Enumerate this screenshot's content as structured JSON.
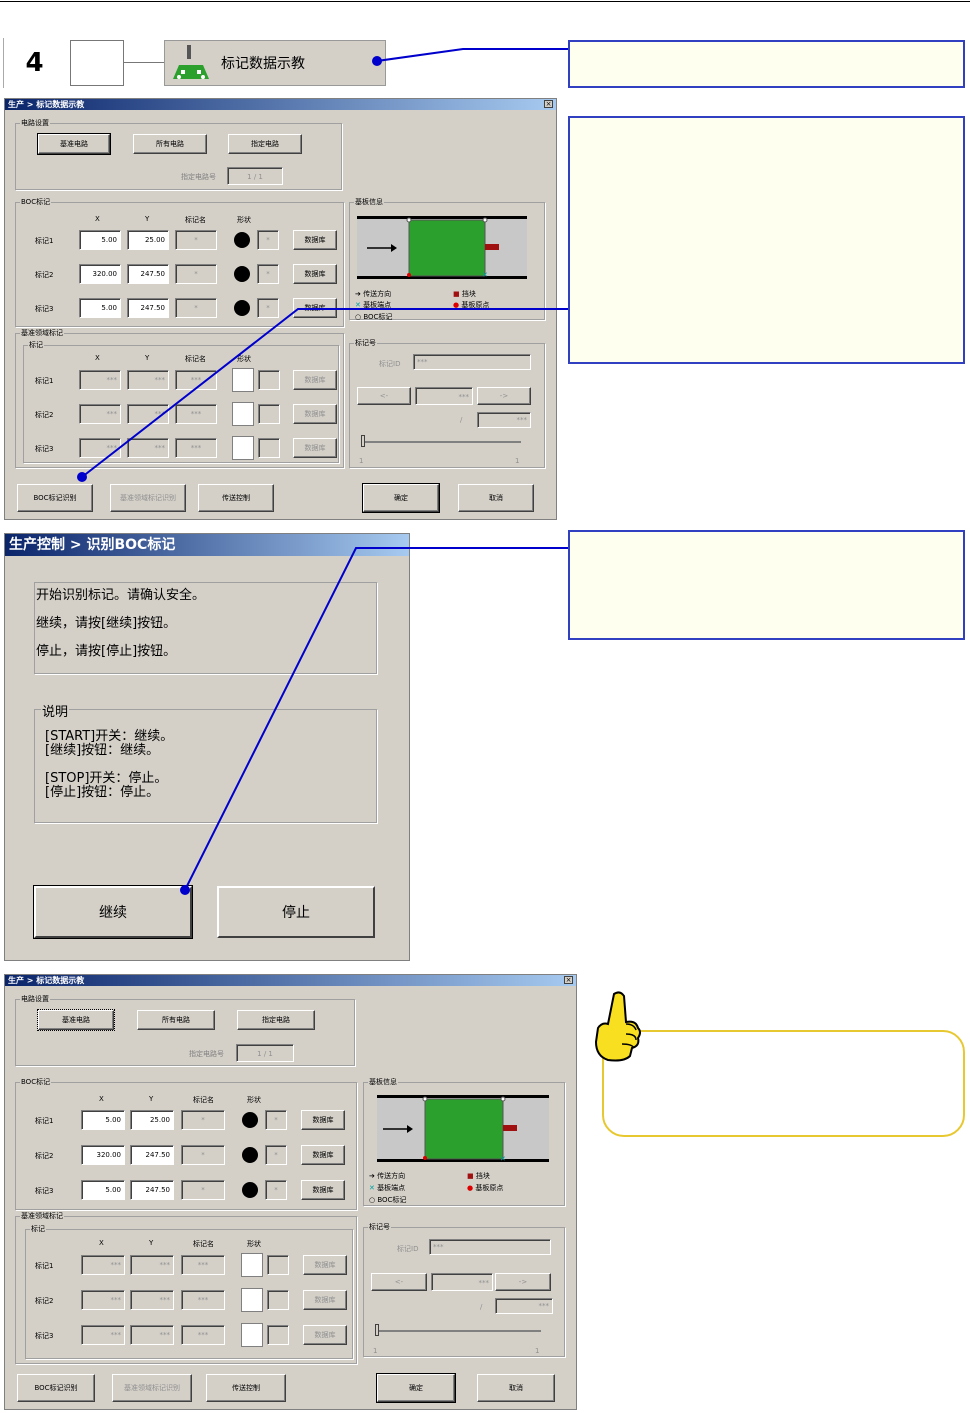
{
  "step": {
    "number": "4",
    "button_label": "标记数据示教"
  },
  "dialog1": {
    "title": "生产 > 标记数据示教",
    "circuit_group": "电路设置",
    "btn_base": "基准电路",
    "btn_all": "所有电路",
    "btn_spec": "指定电路",
    "circuit_no_label": "指定电路号",
    "circuit_no_cur": "1",
    "circuit_no_sep": "/",
    "circuit_no_total": "1",
    "boc_group": "BOC标记",
    "col_x": "X",
    "col_y": "Y",
    "col_name": "标记名",
    "col_shape": "形状",
    "boc_rows": [
      {
        "label": "标记1",
        "x": "5.00",
        "y": "25.00",
        "name": "*",
        "lib": "*",
        "db": "数据库"
      },
      {
        "label": "标记2",
        "x": "320.00",
        "y": "247.50",
        "name": "*",
        "lib": "*",
        "db": "数据库"
      },
      {
        "label": "标记3",
        "x": "5.00",
        "y": "247.50",
        "name": "*",
        "lib": "*",
        "db": "数据库"
      }
    ],
    "board_group": "基板信息",
    "legend_dir": "传送方向",
    "legend_stop": "挡块",
    "legend_corner": "基板端点",
    "legend_origin": "基板原点",
    "legend_boc": "BOC标记",
    "local_group": "基准领域标记",
    "local_sub": "标记",
    "local_rows": [
      {
        "label": "标记1",
        "x": "***",
        "y": "***",
        "name": "***",
        "db": "数据库"
      },
      {
        "label": "标记2",
        "x": "***",
        "y": "***",
        "name": "***",
        "db": "数据库"
      },
      {
        "label": "标记3",
        "x": "***",
        "y": "***",
        "name": "***",
        "db": "数据库"
      }
    ],
    "markno_group": "标记号",
    "markid_label": "标记ID",
    "markid_value": "***",
    "prev": "<-",
    "next": "->",
    "mid_value": "***",
    "slash": "/",
    "total_value": "***",
    "slider_min": "1",
    "slider_max": "1",
    "btn_boc": "BOC标记识别",
    "btn_local": "基准领域标记识别",
    "btn_transfer": "传送控制",
    "btn_ok": "确定",
    "btn_cancel": "取消"
  },
  "dialog2": {
    "title": "生产控制 > 识别BOC标记",
    "msg1": "开始识别标记。请确认安全。",
    "msg2": "继续，请按[继续]按钮。",
    "msg3": "停止，请按[停止]按钮。",
    "desc_label": "说明",
    "desc1": "[START]开关：继续。",
    "desc2": "[继续]按钮：继续。",
    "desc3": "[STOP]开关：停止。",
    "desc4": "[停止]按钮：停止。",
    "btn_continue": "继续",
    "btn_stop": "停止"
  },
  "colors": {
    "note_bg": "#fffff0",
    "note_border": "#3040c0",
    "pointer_line": "#0000cc",
    "board_green": "#2ca02c",
    "tip_border": "#e8c830"
  }
}
